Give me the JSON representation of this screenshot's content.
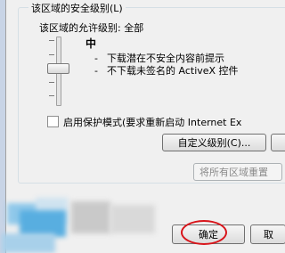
{
  "security_group": {
    "title": "该区域的安全级别(L)",
    "allowed_levels": "该区域的允许级别: 全部",
    "current_level": "中",
    "descriptions": [
      "下载潜在不安全内容前提示",
      "不下载未签名的 ActiveX 控件"
    ],
    "slider_level_fraction": 0.5
  },
  "protected_mode": {
    "checked": false,
    "label": "启用保护模式(要求重新启动 Internet Ex"
  },
  "buttons": {
    "custom_level": "自定义级别(C)...",
    "reset_all": "将所有区域重置",
    "ok": "确定",
    "cancel": "取"
  },
  "colors": {
    "highlight_circle": "#d8141a",
    "group_border": "#d5dfe5"
  }
}
